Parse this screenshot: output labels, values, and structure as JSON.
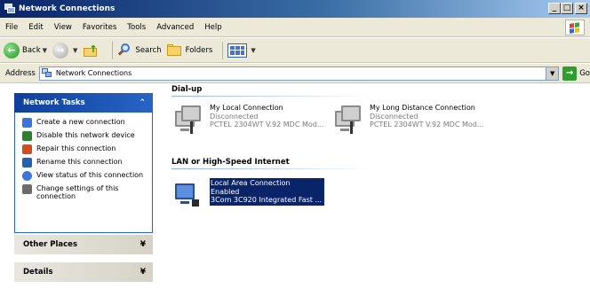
{
  "window": {
    "title": "Network Connections",
    "buttons": [
      "_",
      "□",
      "×"
    ]
  },
  "menu": {
    "items": [
      "File",
      "Edit",
      "View",
      "Favorites",
      "Tools",
      "Advanced",
      "Help"
    ]
  },
  "toolbar": {
    "back_label": "Back",
    "search_label": "Search",
    "folders_label": "Folders"
  },
  "address": {
    "label": "Address",
    "value": "Network Connections",
    "go_label": "Go"
  },
  "left": {
    "tasks": {
      "title": "Network Tasks",
      "chevron": "⌃",
      "items": [
        {
          "label": "Create a new connection",
          "icon": "new-connection-icon",
          "color": "#3a76d6"
        },
        {
          "label": "Disable this network device",
          "icon": "disable-device-icon",
          "color": "#2f7f2f"
        },
        {
          "label": "Repair this connection",
          "icon": "repair-connection-icon",
          "color": "#d04f1a"
        },
        {
          "label": "Rename this connection",
          "icon": "rename-connection-icon",
          "color": "#2a5fb0"
        },
        {
          "label": "View status of this connection",
          "icon": "view-status-icon",
          "color": "#3a76d6"
        },
        {
          "label": "Change settings of this connection",
          "icon": "change-settings-icon",
          "color": "#6b6b6b"
        }
      ]
    },
    "other_places": {
      "title": "Other Places",
      "chevron": "¥"
    },
    "details": {
      "title": "Details",
      "chevron": "¥"
    }
  },
  "main": {
    "dialup": {
      "title": "Dial-up",
      "connections": [
        {
          "name": "My Local Connection",
          "status": "Disconnected",
          "device": "PCTEL 2304WT V.92 MDC Mod..."
        },
        {
          "name": "My Long Distance Connection",
          "status": "Disconnected",
          "device": "PCTEL 2304WT V.92 MDC Mod..."
        }
      ]
    },
    "lan": {
      "title": "LAN or High-Speed Internet",
      "connections": [
        {
          "name": "Local Area Connection",
          "status": "Enabled",
          "device": "3Com 3C920 Integrated Fast ..."
        }
      ]
    }
  },
  "colors": {
    "selection": "#0a246a",
    "task_header": "#2765c4"
  }
}
